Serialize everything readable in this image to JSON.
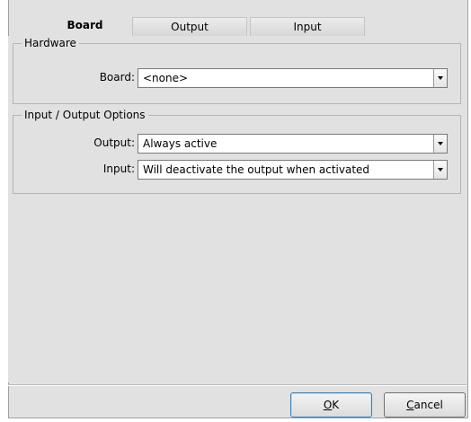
{
  "tabs": [
    {
      "label": "Board",
      "active": true
    },
    {
      "label": "Output",
      "active": false
    },
    {
      "label": "Input",
      "active": false
    }
  ],
  "hardware": {
    "legend": "Hardware",
    "board_label": "Board:",
    "board_value": "<none>"
  },
  "io_options": {
    "legend": "Input / Output Options",
    "output_label": "Output:",
    "output_value": "Always active",
    "input_label": "Input:",
    "input_value": "Will deactivate the output when activated"
  },
  "buttons": {
    "ok_mnemonic": "O",
    "ok_rest": "K",
    "cancel_mnemonic": "C",
    "cancel_rest": "ancel"
  },
  "colors": {
    "panel_bg": "#e1e1e1",
    "default_button_border": "#3c7fb1"
  },
  "icons": {
    "dropdown": "chevron-down-icon"
  }
}
